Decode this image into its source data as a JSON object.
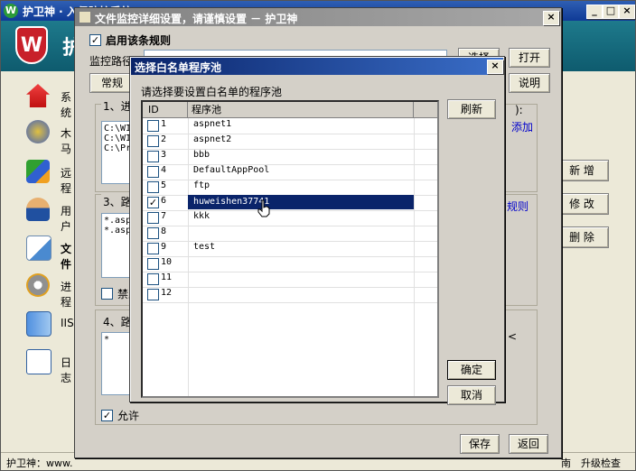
{
  "main_window": {
    "title": "护卫神 · 入侵防护系统",
    "app_letter": "W",
    "header_char": "护",
    "sidebar": [
      {
        "label": "系统",
        "icon": "house-icon"
      },
      {
        "label": "木马",
        "icon": "gear-ball-icon"
      },
      {
        "label": "远程",
        "icon": "network-icon"
      },
      {
        "label": "用户",
        "icon": "user-icon"
      },
      {
        "label": "文件",
        "icon": "pen-file-icon"
      },
      {
        "label": "进程",
        "icon": "process-gear-icon"
      },
      {
        "label": "IIS",
        "icon": "server-icon"
      },
      {
        "label": "日志",
        "icon": "clock-doc-icon"
      }
    ],
    "right_buttons": {
      "add": "新 增",
      "edit": "修 改",
      "delete": "删 除"
    },
    "status_left": "护卫神：www.",
    "status_right_a": "南",
    "status_right_b": "升级检查"
  },
  "settings_dialog": {
    "title": "文件监控详细设置，请谨慎设置 － 护卫神",
    "enable_rule_label": "启用该条规则",
    "monitor_path_label": "监控路径",
    "browse_button": "选择",
    "open_button": "打开",
    "tab_general": "常规",
    "explain_button": "说明",
    "section1_label": "1、进程",
    "section1_suffix": "):",
    "section1_add": "添加",
    "section1_lines": [
      "C:\\WI",
      "C:\\WI",
      "C:\\Pr"
    ],
    "section3_label": "3、路径",
    "section3_rule": "规则",
    "section3_lines": [
      "*.asp",
      "*.asp"
    ],
    "forbid_label": "禁止",
    "section4_label": "4、路径",
    "section4_lines": [
      "*"
    ],
    "section4_mark": "<",
    "allow_label": "允许",
    "save_button": "保存",
    "back_button": "返回"
  },
  "pool_dialog": {
    "title": "选择白名单程序池",
    "prompt": "请选择要设置白名单的程序池",
    "col_id": "ID",
    "col_name": "程序池",
    "refresh_button": "刷新",
    "ok_button": "确定",
    "cancel_button": "取消",
    "rows": [
      {
        "id": "1",
        "name": "aspnet1",
        "checked": false
      },
      {
        "id": "2",
        "name": "aspnet2",
        "checked": false
      },
      {
        "id": "3",
        "name": "bbb",
        "checked": false
      },
      {
        "id": "4",
        "name": "DefaultAppPool",
        "checked": false
      },
      {
        "id": "5",
        "name": "ftp",
        "checked": false
      },
      {
        "id": "6",
        "name": "huweishen37741",
        "checked": true,
        "selected": true
      },
      {
        "id": "7",
        "name": "kkk",
        "checked": false
      },
      {
        "id": "8",
        "name": "",
        "checked": false
      },
      {
        "id": "9",
        "name": "test",
        "checked": false
      },
      {
        "id": "10",
        "name": "",
        "checked": false
      },
      {
        "id": "11",
        "name": "",
        "checked": false
      },
      {
        "id": "12",
        "name": "",
        "checked": false
      }
    ]
  },
  "colors": {
    "titlebar": "#0f3a96",
    "selection": "#0a246a",
    "window_bg": "#ece9d8",
    "link": "#0000cc"
  }
}
